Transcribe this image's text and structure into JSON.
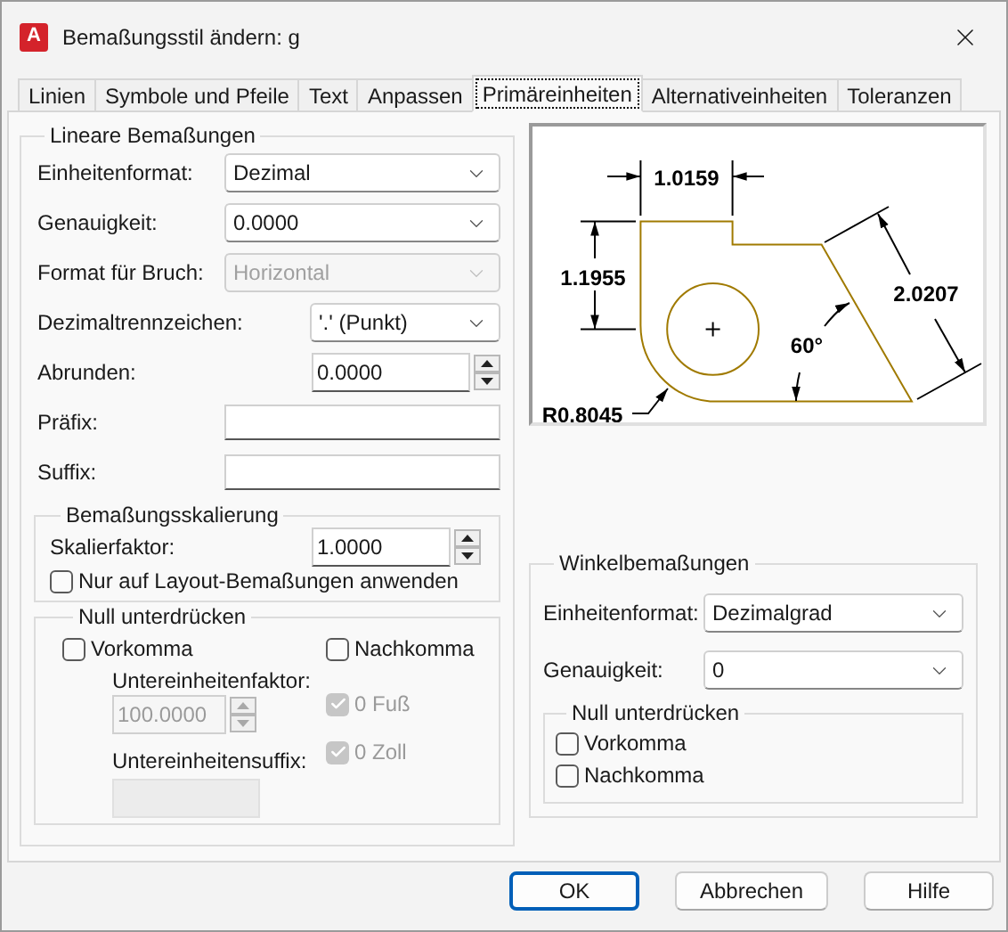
{
  "window": {
    "title": "Bemaßungsstil ändern: g",
    "icon_letter": "A"
  },
  "tabs": [
    {
      "label": "Linien",
      "selected": false
    },
    {
      "label": "Symbole und Pfeile",
      "selected": false
    },
    {
      "label": "Text",
      "selected": false
    },
    {
      "label": "Anpassen",
      "selected": false
    },
    {
      "label": "Primäreinheiten",
      "selected": true
    },
    {
      "label": "Alternativeinheiten",
      "selected": false
    },
    {
      "label": "Toleranzen",
      "selected": false
    }
  ],
  "linear": {
    "title": "Lineare Bemaßungen",
    "fields": [
      {
        "kind": "select",
        "label": "Einheitenformat:",
        "value": "Dezimal",
        "disabled": false
      },
      {
        "kind": "select",
        "label": "Genauigkeit:",
        "value": "0.0000",
        "disabled": false
      },
      {
        "kind": "select",
        "label": "Format für Bruch:",
        "value": "Horizontal",
        "disabled": true
      },
      {
        "kind": "short-select",
        "label": "Dezimaltrennzeichen:",
        "value": "'.' (Punkt)",
        "disabled": false
      },
      {
        "kind": "spin",
        "label": "Abrunden:",
        "value": "0.0000",
        "disabled": false
      },
      {
        "kind": "text",
        "label": "Präfix:",
        "disabled": false
      },
      {
        "kind": "text",
        "label": "Suffix:",
        "disabled": false
      }
    ],
    "scaling": {
      "title": "Bemaßungsskalierung",
      "factor_label": "Skalierfaktor:",
      "factor_value": "1.0000",
      "layout_only": {
        "label": "Nur auf Layout-Bemaßungen anwenden",
        "checked": false
      }
    },
    "zero_suppression": {
      "title": "Null unterdrücken",
      "leading": {
        "label": "Vorkomma",
        "checked": false
      },
      "trailing": {
        "label": "Nachkomma",
        "checked": false
      },
      "sub_unit_factor": {
        "label": "Untereinheitenfaktor:",
        "value": "100.0000",
        "disabled": true
      },
      "sub_unit_suffix": {
        "label": "Untereinheitensuffix:",
        "disabled": true
      },
      "feet": {
        "label": "0 Fuß",
        "checked": true,
        "disabled": true
      },
      "inches": {
        "label": "0 Zoll",
        "checked": true,
        "disabled": true
      }
    }
  },
  "preview": {
    "width_label": "1.0159",
    "height_label": "1.1955",
    "slant_label": "2.0207",
    "angle_label": "60°",
    "radius_label": "R0.8045"
  },
  "angular": {
    "title": "Winkelbemaßungen",
    "fields": [
      {
        "label": "Einheitenformat:",
        "value": "Dezimalgrad"
      },
      {
        "label": "Genauigkeit:",
        "value": "0"
      }
    ],
    "zero_suppression": {
      "title": "Null unterdrücken",
      "options": [
        {
          "label": "Vorkomma",
          "checked": false
        },
        {
          "label": "Nachkomma",
          "checked": false
        }
      ]
    }
  },
  "buttons": [
    {
      "label": "OK",
      "default": true
    },
    {
      "label": "Abbrechen",
      "default": false
    },
    {
      "label": "Hilfe",
      "default": false
    }
  ]
}
